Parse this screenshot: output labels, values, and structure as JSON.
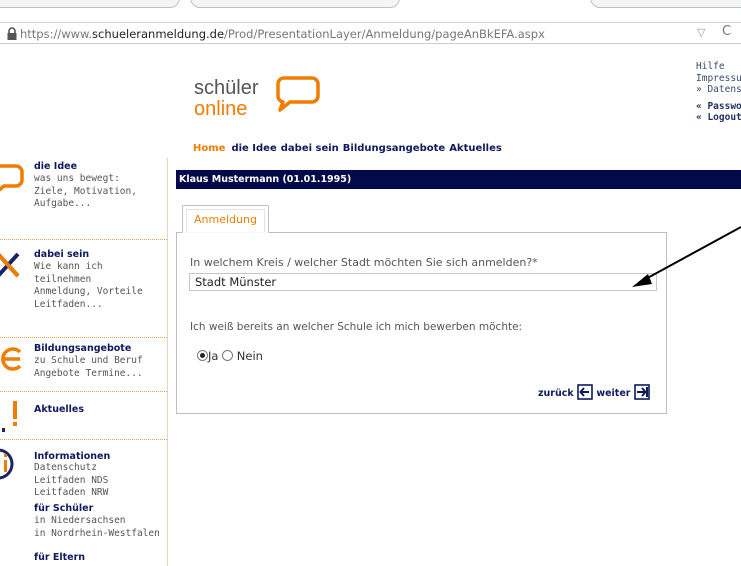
{
  "browser": {
    "url_prefix": "https://www.",
    "url_domain": "schueleranmeldung.de",
    "url_path": "/Prod/PresentationLayer/Anmeldung/pageAnBkEFA.aspx",
    "bookmark_glyph": "▽",
    "reload_glyph": "C"
  },
  "header": {
    "logo_line1": "schüler",
    "logo_line2": "online",
    "brand_color": "#f07d00",
    "toplinks": {
      "hilfe": "Hilfe",
      "impressum": "Impressu",
      "datenschutz": "» Datens",
      "passwort": "« Passwo",
      "logout": "« Logout"
    },
    "nav": [
      "Home",
      "die Idee",
      "dabei sein",
      "Bildungsangebote",
      "Aktuelles"
    ]
  },
  "sidebar": {
    "idee": {
      "title": "die Idee",
      "desc": [
        "was uns bewegt:",
        "Ziele, Motivation,",
        "Aufgabe..."
      ]
    },
    "dabei": {
      "title": "dabei sein",
      "desc": [
        "Wie kann ich",
        "teilnehmen",
        "Anmeldung, Vorteile",
        "Leitfaden..."
      ]
    },
    "bildung": {
      "title": "Bildungsangebote",
      "desc": [
        "zu Schule und Beruf",
        "Angebote Termine..."
      ]
    },
    "aktuelles": {
      "title": "Aktuelles"
    },
    "info": {
      "title": "Informationen",
      "desc": [
        "Datenschutz",
        "Leitfaden NDS",
        "Leitfaden NRW"
      ],
      "schueler_title": "für Schüler",
      "schueler_desc": [
        "in Niedersachsen",
        "in Nordrhein-Westfalen"
      ],
      "eltern_title": "für Eltern"
    }
  },
  "main": {
    "user": "Klaus Mustermann (01.01.1995)",
    "tab_label": "Anmeldung",
    "question1": "In welchem Kreis / welcher Stadt möchten Sie sich anmelden?*",
    "city_selected": "Stadt Münster",
    "question2": "Ich weiß bereits an welcher Schule ich mich bewerben möchte:",
    "radio_yes": "Ja",
    "radio_no": "Nein",
    "radio_selected": "Ja",
    "back_label": "zurück",
    "next_label": "weiter"
  }
}
